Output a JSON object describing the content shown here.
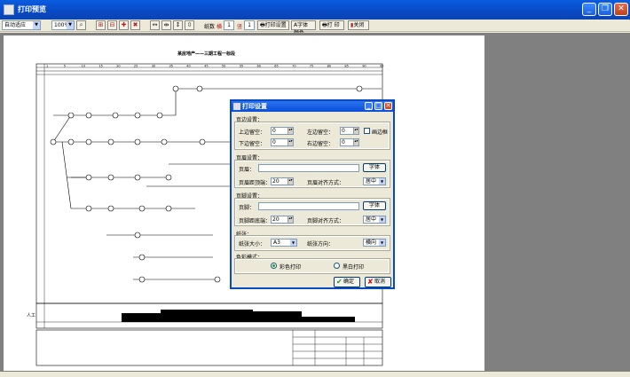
{
  "window": {
    "title": "打印预览"
  },
  "toolbar": {
    "fit_mode": "自动适应",
    "zoom": "100%",
    "pages_label": "纸数",
    "horizontal_label": "横",
    "horizontal_value": "1",
    "vertical_label": "竖",
    "vertical_value": "1",
    "print_setup": "打印设置",
    "font_color": "字体颜色",
    "print": "打 印",
    "close": "关闭"
  },
  "sheet": {
    "title": "某房地产——三期工程一标段",
    "top_axis_numbers": [
      "1",
      "5",
      "10",
      "15",
      "20",
      "25",
      "30",
      "35",
      "40",
      "45",
      "50",
      "55",
      "60",
      "65",
      "70",
      "75",
      "80",
      "85",
      "90",
      "95"
    ],
    "histogram_label": "人工"
  },
  "dialog": {
    "title": "打印设置",
    "margins": {
      "label": "页边设置：",
      "top_label": "上边留空：",
      "top_value": "0",
      "left_label": "左边留空：",
      "left_value": "0",
      "bottom_label": "下边留空：",
      "bottom_value": "0",
      "right_label": "右边留空：",
      "right_value": "0",
      "border_label": "画边框"
    },
    "header": {
      "label": "页眉设置：",
      "text_label": "页眉：",
      "text_value": "",
      "font_button": "字体",
      "distance_label": "页眉距顶端：",
      "distance_value": "20",
      "align_label": "页眉对齐方式：",
      "align_value": "居中"
    },
    "footer": {
      "label": "页脚设置：",
      "text_label": "页脚：",
      "text_value": "",
      "font_button": "字体",
      "distance_label": "页脚距底端：",
      "distance_value": "20",
      "align_label": "页脚对齐方式：",
      "align_value": "居中"
    },
    "paper": {
      "label": "纸张：",
      "size_label": "纸张大小：",
      "size_value": "A3",
      "orientation_label": "纸张方向：",
      "orientation_value": "横向"
    },
    "color": {
      "label": "色彩模式：",
      "color_option": "彩色打印",
      "bw_option": "黑白打印",
      "selected": "彩色打印"
    },
    "ok": "确定",
    "cancel": "取消"
  },
  "colors": {
    "titlebar": "#0849c4",
    "canvas": "#808080",
    "dialog_bg": "#ece9d8",
    "chart_ink": "#000000"
  }
}
